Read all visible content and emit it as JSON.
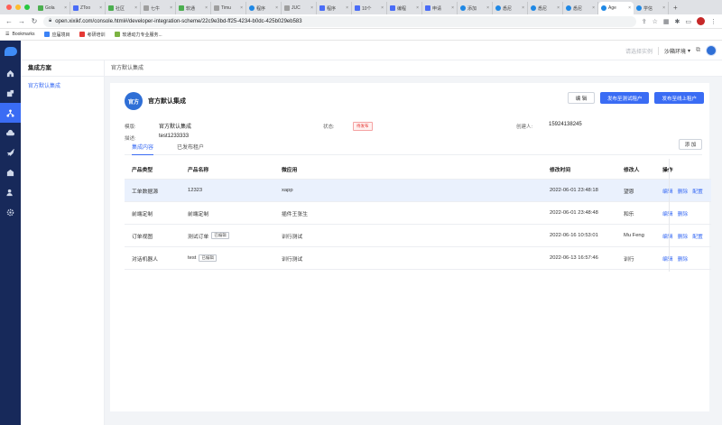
{
  "browser": {
    "tabs": [
      {
        "label": "Gola"
      },
      {
        "label": "ZToo"
      },
      {
        "label": "社区"
      },
      {
        "label": "七牛"
      },
      {
        "label": "软通"
      },
      {
        "label": "Timu"
      },
      {
        "label": "程序"
      },
      {
        "label": "JUC"
      },
      {
        "label": "程序"
      },
      {
        "label": "10个"
      },
      {
        "label": "编程"
      },
      {
        "label": "申请"
      },
      {
        "label": "添加"
      },
      {
        "label": "悉尼"
      },
      {
        "label": "悉尼"
      },
      {
        "label": "悉尼"
      },
      {
        "label": "Age"
      },
      {
        "label": "学信"
      }
    ],
    "url": "open.xixikf.com/console.html#/developer-integration-scheme/22c9e3bd-ff25-4234-b0dc-425b029eb583",
    "bookmarks": [
      {
        "label": "Bookmarks"
      },
      {
        "label": "应届境目"
      },
      {
        "label": "考研培训"
      },
      {
        "label": "软通动力专业服务..."
      }
    ]
  },
  "topbar": {
    "instance_placeholder": "请选择实例",
    "env_label": "沙箱环境",
    "env_caret": "▾"
  },
  "subnav": {
    "title": "集成方案",
    "items": [
      {
        "label": "官方默认集成"
      }
    ]
  },
  "breadcrumb": "官方默认集成",
  "scheme": {
    "badge": "官方",
    "title": "官方默认集成",
    "edit_label": "编 辑",
    "publish_test_label": "发布至测试租户",
    "publish_live_label": "发布至线上租户",
    "template_label": "模版:",
    "template_value": "官方默认集成",
    "status_label": "状态:",
    "status_value": "待发布",
    "creator_label": "创建人:",
    "creator_value": "15924138245",
    "desc_label": "描述:",
    "desc_value": "test1233333"
  },
  "inner_tabs": [
    {
      "label": "集成内容"
    },
    {
      "label": "已发布租户"
    }
  ],
  "add_label": "添 加",
  "table": {
    "headers": [
      "产品类型",
      "产品名称",
      "微应用",
      "修改时间",
      "修改人",
      "操作"
    ],
    "rows": [
      {
        "type": "工单数据源",
        "name": "12323",
        "tag": "",
        "app": "xapp",
        "time": "2022-06-01 23:48:18",
        "user": "望恩",
        "ops": [
          "编辑",
          "删除",
          "配置"
        ]
      },
      {
        "type": "前端定制",
        "name": "前端定制",
        "tag": "",
        "app": "插件王张生",
        "time": "2022-06-01 23:48:48",
        "user": "和乐",
        "ops": [
          "编辑",
          "删除"
        ]
      },
      {
        "type": "订单视图",
        "name": "测试订单",
        "tag": "已编辑",
        "app": "训行测试",
        "time": "2022-06-16 10:53:01",
        "user": "Mu Feng",
        "ops": [
          "编辑",
          "删除",
          "配置"
        ]
      },
      {
        "type": "对话机器人",
        "name": "test",
        "tag": "已编辑",
        "app": "训行测试",
        "time": "2022-06-13 16:57:46",
        "user": "训行",
        "ops": [
          "编辑",
          "删除"
        ]
      }
    ]
  }
}
